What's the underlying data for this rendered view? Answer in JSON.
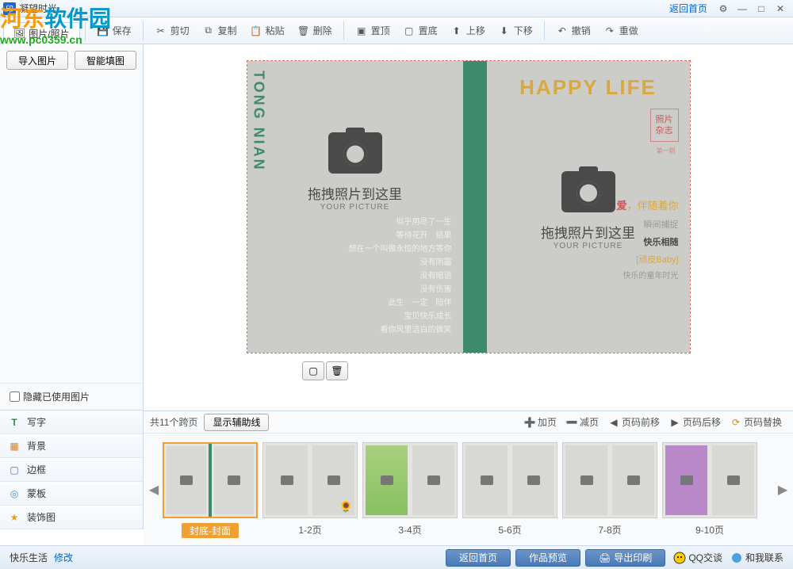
{
  "titlebar": {
    "icon": "印",
    "title": "凝望时光",
    "home_link": "返回首页"
  },
  "watermark": {
    "brand1": "河东",
    "brand2": "软件园",
    "url": "www.pc0359.cn"
  },
  "toolbar": {
    "tab_photos": "图片/照片",
    "save": "保存",
    "cut": "剪切",
    "copy": "复制",
    "paste": "粘贴",
    "delete": "删除",
    "front": "置顶",
    "back": "置底",
    "up": "上移",
    "down": "下移",
    "undo": "撤销",
    "redo": "重做"
  },
  "sidebar": {
    "import": "导入图片",
    "smartfill": "智能填图",
    "hide_used": "隐藏已使用图片",
    "panels": [
      {
        "icon": "T",
        "color": "#2a8a4a",
        "label": "写字"
      },
      {
        "icon": "▦",
        "color": "#d08030",
        "label": "背景"
      },
      {
        "icon": "▢",
        "color": "#4070c0",
        "label": "边框"
      },
      {
        "icon": "◎",
        "color": "#4090d0",
        "label": "蒙板"
      },
      {
        "icon": "★",
        "color": "#e0a020",
        "label": "装饰图"
      }
    ]
  },
  "canvas": {
    "back": {
      "drag": "拖拽照片到这里",
      "sub": "YOUR PICTURE",
      "lines": [
        "似乎用尽了一生",
        "等待花开　结果",
        "想在一个叫做永恒的地方等你",
        "没有阴霾",
        "没有暗语",
        "没有伤害",
        "此生　一定　陪伴",
        "宝贝快乐成长",
        "看你风里洁白的微笑"
      ]
    },
    "spine": "TONG NIAN",
    "front": {
      "title": "HAPPY  LIFE",
      "stamp1": "照片",
      "stamp2": "杂志",
      "stamp3": "第一期",
      "drag": "拖拽照片到这里",
      "sub": "YOUR PICTURE",
      "s1a": "爱",
      "s1b": "，伴随着你",
      "s2": "瞬间捕捉",
      "s3": "快乐相随",
      "s4": "[顽皮Baby]",
      "s5": "快乐的童年时光"
    }
  },
  "thumbs": {
    "count": "共11个跨页",
    "aux": "显示辅助线",
    "add": "加页",
    "remove": "减页",
    "fwd": "页码前移",
    "bwd": "页码后移",
    "replace": "页码替换",
    "items": [
      "封底-封面",
      "1-2页",
      "3-4页",
      "5-6页",
      "7-8页",
      "9-10页"
    ]
  },
  "status": {
    "name": "快乐生活",
    "edit": "修改",
    "home": "返回首页",
    "preview": "作品预览",
    "export": "导出印刷",
    "qq": "QQ交谈",
    "contact": "和我联系"
  }
}
